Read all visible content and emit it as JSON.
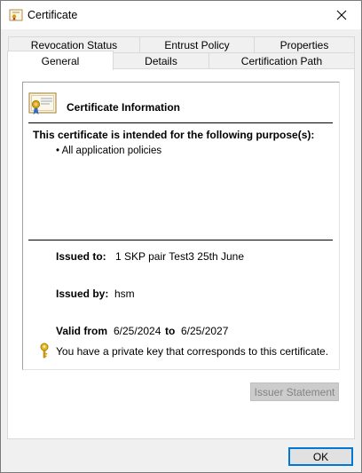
{
  "window": {
    "title": "Certificate",
    "close_label": "Close"
  },
  "tabs": {
    "row_back": [
      "Revocation Status",
      "Entrust Policy",
      "Properties"
    ],
    "row_front": [
      "General",
      "Details",
      "Certification Path"
    ],
    "selected": "General"
  },
  "general": {
    "header": "Certificate Information",
    "purpose_heading": "This certificate is intended for the following purpose(s):",
    "purposes": [
      "• All application policies"
    ],
    "issued_to_label": "Issued to:",
    "issued_to_value": "1 SKP pair  Test3 25th June",
    "issued_by_label": "Issued by:",
    "issued_by_value": "hsm",
    "valid_from_label": "Valid from",
    "valid_from_value": "6/25/2024",
    "valid_to_label": "to",
    "valid_to_value": "6/25/2027",
    "private_key_text": "You have a private key that corresponds to this certificate.",
    "issuer_statement_label": "Issuer Statement"
  },
  "footer": {
    "ok_label": "OK"
  },
  "colors": {
    "accent": "#0078d7",
    "ribbon": "#d4a017",
    "disabled_text": "#838383"
  }
}
